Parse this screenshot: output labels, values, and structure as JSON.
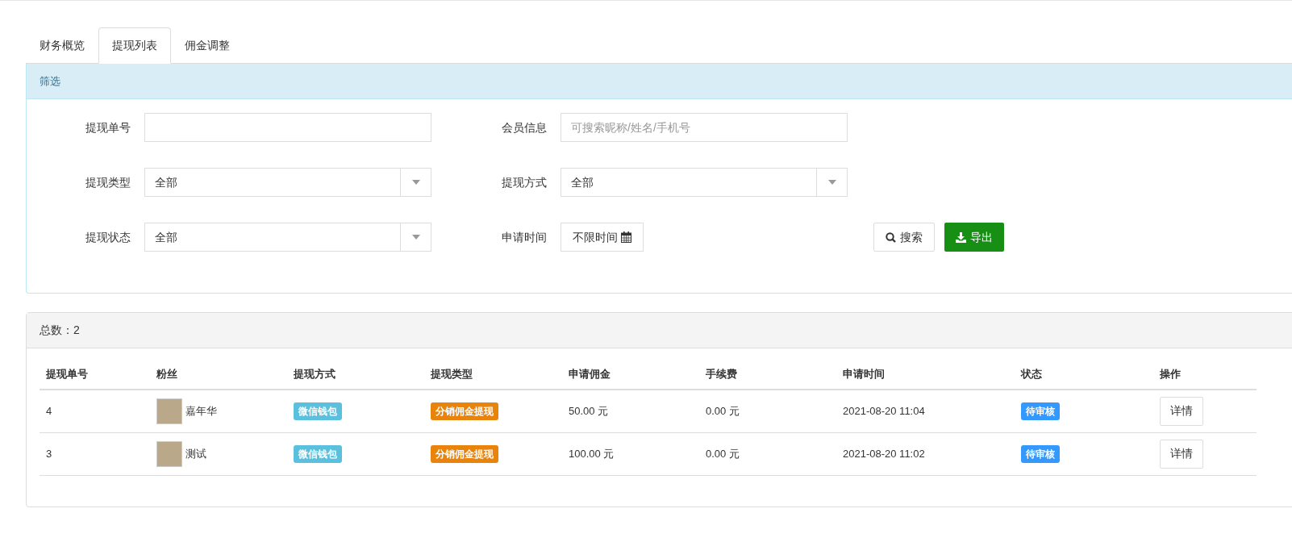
{
  "tabs": [
    {
      "label": "财务概览",
      "selected": false
    },
    {
      "label": "提现列表",
      "selected": true
    },
    {
      "label": "佣金调整",
      "selected": false
    }
  ],
  "filter": {
    "title": "筛选",
    "fields": [
      {
        "kind": "text",
        "label": "提现单号"
      },
      {
        "kind": "text",
        "label": "会员信息",
        "placeholder": "可搜索昵称/姓名/手机号"
      },
      {
        "kind": "select",
        "label": "提现类型",
        "value": "全部"
      },
      {
        "kind": "select",
        "label": "提现方式",
        "value": "全部"
      },
      {
        "kind": "select",
        "label": "提现状态",
        "value": "全部"
      },
      {
        "kind": "date",
        "label": "申请时间",
        "value": "不限时间"
      }
    ],
    "search_button": "搜索",
    "export_button": "导出"
  },
  "list": {
    "total_label": "总数：2",
    "columns": [
      "提现单号",
      "粉丝",
      "提现方式",
      "提现类型",
      "申请佣金",
      "手续费",
      "申请时间",
      "状态",
      "操作"
    ],
    "rows": [
      {
        "id": "4",
        "fan": "嘉年华",
        "method": "微信钱包",
        "type": "分销佣金提现",
        "amount": "50.00 元",
        "fee": "0.00 元",
        "time": "2021-08-20 11:04",
        "status": "待审核",
        "action": "详情"
      },
      {
        "id": "3",
        "fan": "测试",
        "method": "微信钱包",
        "type": "分销佣金提现",
        "amount": "100.00 元",
        "fee": "0.00 元",
        "time": "2021-08-20 11:02",
        "status": "待审核",
        "action": "详情"
      }
    ]
  }
}
